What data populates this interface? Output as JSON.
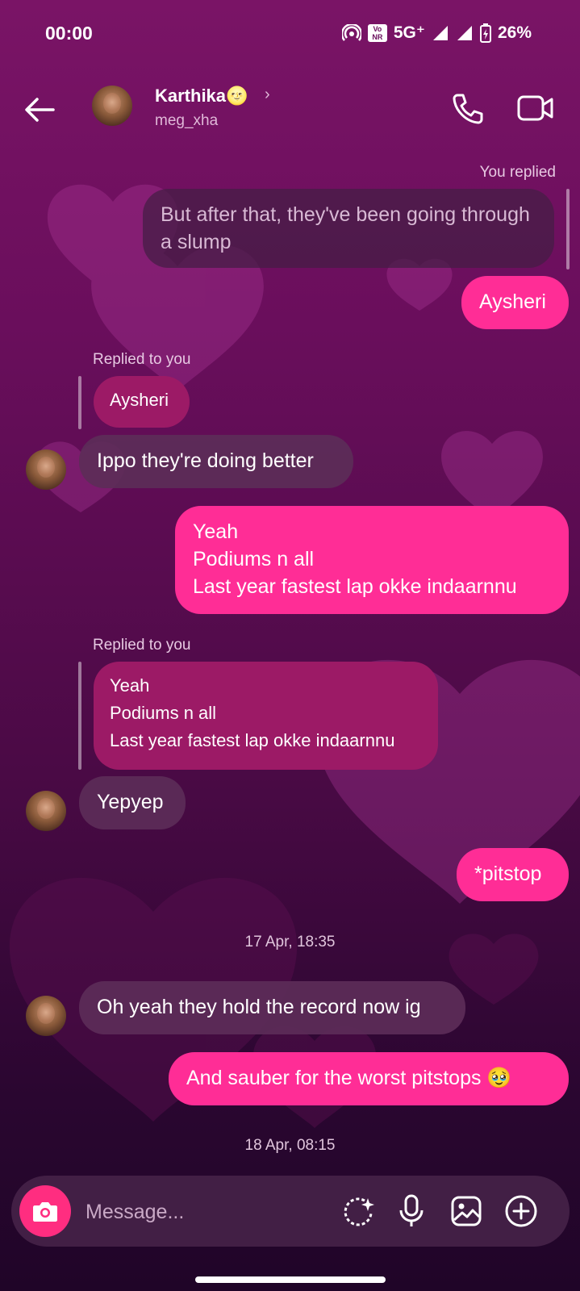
{
  "status_bar": {
    "time": "00:00",
    "network": "5G⁺",
    "volte_badge": "Vo NR",
    "battery": "26%"
  },
  "header": {
    "contact_name": "Karthika🌝",
    "contact_username": "meg_xha",
    "chevron": "›"
  },
  "messages": {
    "m1": {
      "label": "You replied",
      "quoted": "But after that, they've been going through a slump",
      "text": "Aysheri"
    },
    "m2": {
      "label": "Replied to you",
      "quoted": "Aysheri",
      "text": "Ippo they're doing better"
    },
    "m3": {
      "text": "Yeah\nPodiums n all\nLast year fastest lap okke indaarnnu"
    },
    "m4": {
      "label": "Replied to you",
      "quoted": "Yeah\nPodiums n all\nLast year fastest lap okke indaarnnu",
      "text": "Yepyep"
    },
    "m5": {
      "text": "*pitstop"
    },
    "ts1": "17 Apr, 18:35",
    "m6": {
      "text": "Oh yeah they hold the record now ig"
    },
    "m7": {
      "text": "And sauber for the worst pitstops 🥹"
    },
    "ts2": "18 Apr, 08:15"
  },
  "composer": {
    "placeholder": "Message..."
  },
  "colors": {
    "outgoing": "#ff2d96",
    "incoming": "#5c2d58",
    "camera": "#ff2d80"
  },
  "icons": [
    "back-arrow-icon",
    "phone-icon",
    "video-camera-icon",
    "camera-icon",
    "sticker-sparkle-icon",
    "microphone-icon",
    "gallery-icon",
    "plus-circle-icon"
  ]
}
